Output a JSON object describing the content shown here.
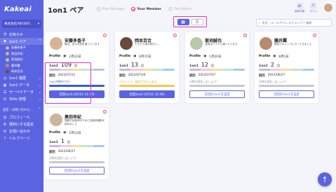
{
  "app": {
    "logo": "Kakeai",
    "company": "株式会社ABCDEF...",
    "company_caret": "▾"
  },
  "sidebar": {
    "items": [
      {
        "icon": "bell-icon",
        "glyph": "◔",
        "label": "お知らせ"
      },
      {
        "icon": "people-icon",
        "glyph": "◉",
        "label": "1on1 ペア",
        "caret": "^"
      }
    ],
    "members": [
      {
        "label": "安藤多香子",
        "color": "#d8b296"
      },
      {
        "label": "奥田早紀",
        "color": "#c8b79a"
      },
      {
        "label": "菊池誠也",
        "color": "#b8c8a8"
      },
      {
        "label": "藤井翼",
        "color": "#b88a70"
      },
      {
        "label": "岡本百合",
        "color": "#6a4a3a"
      }
    ],
    "items2": [
      {
        "icon": "history-icon",
        "glyph": "◷",
        "label": "1on1 履歴",
        "caret": "⌄"
      },
      {
        "icon": "data-icon",
        "glyph": "▦",
        "label": "1on1 データ",
        "caret": "⌄"
      },
      {
        "icon": "survey-icon",
        "glyph": "☰",
        "label": "サーベイデータ",
        "caret": "⌄"
      },
      {
        "icon": "todo-icon",
        "glyph": "☑",
        "label": "ToDo 管理",
        "caret": "⌄"
      }
    ],
    "section_label": "設定・お問い合わせ…",
    "section_caret": "^",
    "items3": [
      {
        "icon": "profile-icon",
        "glyph": "☺",
        "label": "プロフィール"
      },
      {
        "icon": "settings-icon",
        "glyph": "⚙",
        "label": "便利にする設定"
      },
      {
        "icon": "contact-icon",
        "glyph": "✉",
        "label": "お問い合わせ"
      },
      {
        "icon": "help-icon",
        "glyph": "?",
        "label": "ヘルプページ"
      }
    ]
  },
  "header": {
    "title": "1on1 ペア",
    "modes": [
      {
        "label": "Your Manager",
        "glyph": "◌",
        "active": false
      },
      {
        "label": "Your Member",
        "glyph": "★",
        "active": true
      },
      {
        "label": "The Others",
        "glyph": "◌",
        "active": false
      }
    ],
    "buttons": [
      {
        "label": "画面切替",
        "glyph": "⇄"
      },
      {
        "label": "ガイド",
        "glyph": "?"
      }
    ]
  },
  "view_toggle": {
    "grid_icon": "▦",
    "list_icon": "☰"
  },
  "search": {
    "placeholder": "氏名・メールアドレスでメンバー検索",
    "icon": "⌕"
  },
  "card_labels": {
    "profile": "Profile",
    "onon": "1on1",
    "unit": "回",
    "prev": "前回"
  },
  "cards": [
    {
      "name": "安藤多香子",
      "bio": "最近、百の写真を撮っています",
      "profile_date": "2月22日",
      "count": "109",
      "prev": "2023/07/21",
      "note": "1on1中断中です！",
      "note_color": "blue",
      "progress": "#3b5bd9",
      "button": "次回1on1 (07/21 11:30)",
      "button_style": "primary",
      "avatar": "#d8b296",
      "bar": [
        "#c8b7e8",
        "#f6c8d8",
        "#f0e0a0",
        "#bfe6d0",
        "#a8c8f0"
      ]
    },
    {
      "name": "岡本百合",
      "bio": "そろそろ海外旅行に…",
      "profile_date": "6月15日",
      "count": "13",
      "prev": "2023/07/20",
      "note": "リマインド：設定されています",
      "note_color": "orange",
      "progress": "#f5c84a",
      "button": "次回1on1 (07/21 12:30)",
      "button_style": "primary",
      "avatar": "#6a4a3a",
      "bar": [
        "#c8b7e8",
        "#f6c8d8",
        "#f0e0a0",
        "#bfe6d0",
        "#a8c8f0"
      ]
    },
    {
      "name": "菊池誠也",
      "bio": "週末はサウナに通っています",
      "profile_date": "1月20日",
      "count": "12",
      "prev": "2023/07/07",
      "note": "日時を設定しましょう！",
      "note_color": "gray",
      "progress": "#c8c8d0",
      "button": "次回の1on1を設定",
      "button_style": "outline",
      "avatar": "#b8c8a8",
      "bar": [
        "#c8b7e8",
        "#f6c8d8",
        "#f0e0a0",
        "#bfe6d0",
        "#a8c8f0"
      ]
    },
    {
      "name": "藤井翼",
      "bio": "家族でキャンプに行ってきました",
      "profile_date": "8月1日",
      "count": "2",
      "prev": "2023/06/27",
      "note": "日時を設定しましょう！",
      "note_color": "gray",
      "progress": "#c8c8d0",
      "button": "次回の1on1を設定",
      "button_style": "outline",
      "avatar": "#b88a70",
      "bar": [
        "#c8b7e8",
        "#f6c8d8",
        "#f0e0a0",
        "#bfe6d0",
        "#a8c8f0"
      ]
    },
    {
      "name": "奥田早紀",
      "bio": "運動不足解消のために自転車通勤を始めました",
      "profile_date": "2月23日",
      "count": "1",
      "prev": "2023/06/27",
      "note": "日時を設定しましょう！",
      "note_color": "gray",
      "progress": "#c8c8d0",
      "button": "次回の1on1を設定",
      "button_style": "outline",
      "avatar": "#c8b79a",
      "bar": [
        "#c8b7e8",
        "#f6c8d8",
        "#f0e0a0",
        "#bfe6d0",
        "#a8c8f0"
      ]
    }
  ],
  "fab": {
    "glyph": "↑"
  }
}
